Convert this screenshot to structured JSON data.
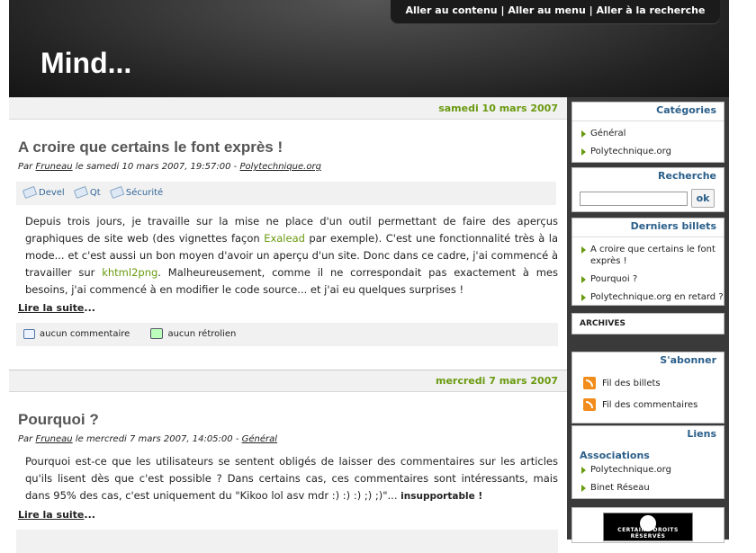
{
  "header": {
    "skip_links": [
      "Aller au contenu",
      "Aller au menu",
      "Aller à la recherche"
    ],
    "site_title": "Mind..."
  },
  "posts": [
    {
      "date": "samedi 10 mars 2007",
      "title": "A croire que certains le font exprès !",
      "info_prefix": "Par",
      "author": "Fruneau",
      "info_middle": "le samedi 10 mars 2007, 19:57:00 -",
      "category": "Polytechnique.org",
      "tags": [
        "Devel",
        "Qt",
        "Sécurité"
      ],
      "content": {
        "p1": "Depuis trois jours, je travaille sur la mise ne place d'un outil permettant de faire des aperçus graphiques de site web (des vignettes façon ",
        "link1": "Exalead",
        "p2": " par exemple). C'est une fonctionnalité très à la mode... et c'est aussi un bon moyen d'avoir un aperçu d'un site. Donc dans ce cadre, j'ai commencé à travailler sur ",
        "link2": "khtml2png",
        "p3": ". Malheureusement, comme il ne correspondait pas exactement à mes besoins, j'ai commencé à en modifier le code source... et j'ai eu quelques surprises !"
      },
      "read_more": "Lire la suite",
      "read_more_suffix": "...",
      "comments": "aucun commentaire",
      "trackbacks": "aucun rétrolien"
    },
    {
      "date": "mercredi 7 mars 2007",
      "title": "Pourquoi ?",
      "info_prefix": "Par",
      "author": "Fruneau",
      "info_middle": "le mercredi 7 mars 2007, 14:05:00 -",
      "category": "Général",
      "content": {
        "p1": "Pourquoi est-ce que les utilisateurs se sentent obligés de laisser des commentaires sur les articles qu'ils lisent dès que c'est possible ? Dans certains cas, ces commentaires sont intéressants, mais dans 95% des cas, c'est uniquement du \"Kikoo lol asv mdr :) :) :) ;) ;)\"... ",
        "strong": "insupportable !"
      },
      "read_more": "Lire la suite",
      "read_more_suffix": "..."
    }
  ],
  "sidebar": {
    "categories": {
      "title": "Catégories",
      "items": [
        "Général",
        "Polytechnique.org"
      ]
    },
    "search": {
      "title": "Recherche",
      "button": "ok",
      "value": ""
    },
    "latest": {
      "title": "Derniers billets",
      "items": [
        "A croire que certains le font exprès !",
        "Pourquoi ?",
        "Polytechnique.org en retard ?"
      ]
    },
    "archives": {
      "label": "ARCHIVES"
    },
    "subscribe": {
      "title": "S'abonner",
      "items": [
        "Fil des billets",
        "Fil des commentaires"
      ]
    },
    "links": {
      "title": "Liens",
      "group": "Associations",
      "items": [
        "Polytechnique.org",
        "Binet Réseau"
      ]
    },
    "license": {
      "text": "CERTAINS DROITS RÉSERVÉS"
    }
  }
}
